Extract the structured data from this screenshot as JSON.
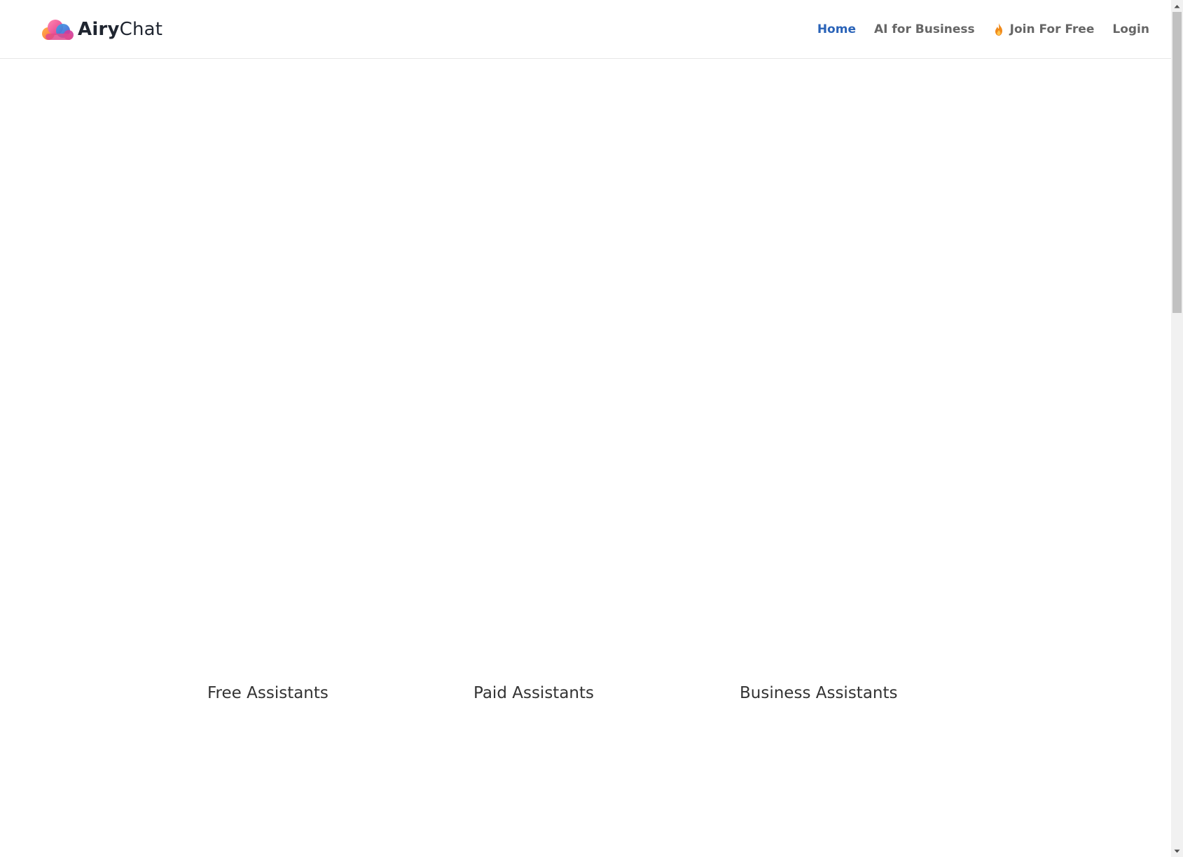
{
  "brand": {
    "name_strong": "Airy",
    "name_light": "Chat",
    "logo_icon": "cloud-logo-icon"
  },
  "nav": {
    "home": "Home",
    "business": "AI for Business",
    "join": "Join For Free",
    "join_icon": "fire-icon",
    "login": "Login"
  },
  "tabs": {
    "free": "Free Assistants",
    "paid": "Paid Assistants",
    "business": "Business Assistants"
  },
  "colors": {
    "active_nav": "#2a63b8",
    "nav_text": "#666666",
    "fire": "#f08a1c"
  }
}
